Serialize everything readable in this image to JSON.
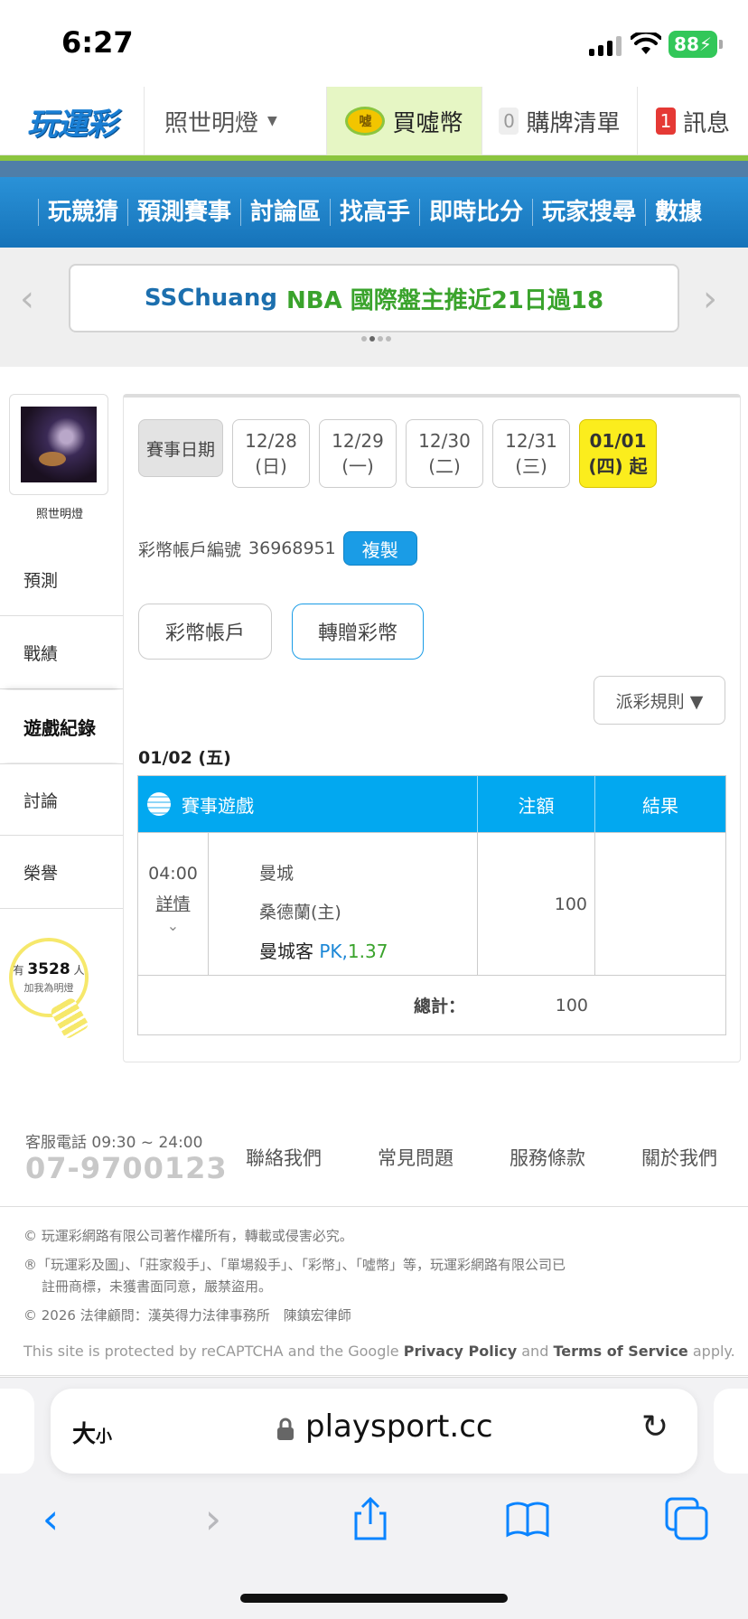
{
  "status_bar": {
    "time": "6:27",
    "battery": "88"
  },
  "topnav": {
    "logo": "玩運彩",
    "user": "照世明燈",
    "buy_coin": "買噓幣",
    "coin_icon_text": "噓",
    "cart_count": "0",
    "cart_label": "購牌清單",
    "msg_count": "1",
    "msg_label": "訊息"
  },
  "mainnav": [
    "玩競猜",
    "預測賽事",
    "討論區",
    "找高手",
    "即時比分",
    "玩家搜尋",
    "數據"
  ],
  "banner": {
    "part1": "SSChuang",
    "part2": "NBA 國際盤主推近21日過18"
  },
  "sidebar": {
    "name": "照世明燈",
    "items": [
      "預測",
      "戰績",
      "遊戲紀錄",
      "討論",
      "榮譽"
    ],
    "active": "遊戲紀錄",
    "fans_prefix": "有",
    "fans_count": "3528",
    "fans_suffix": "人",
    "fans_note": "加我為明燈"
  },
  "content": {
    "date_label": "賽事日期",
    "dates": [
      {
        "date": "12/28",
        "day": "(日)"
      },
      {
        "date": "12/29",
        "day": "(一)"
      },
      {
        "date": "12/30",
        "day": "(二)"
      },
      {
        "date": "12/31",
        "day": "(三)"
      },
      {
        "date": "01/01",
        "day": "(四) 起"
      }
    ],
    "selected_date": "01/01",
    "account_label": "彩幣帳戶編號",
    "account_number": "36968951",
    "copy_label": "複製",
    "tab_account": "彩幣帳戶",
    "tab_transfer": "轉贈彩幣",
    "rules_label": "派彩規則 ▼",
    "section_date": "01/02 (五)",
    "table": {
      "headers": [
        "賽事遊戲",
        "注額",
        "結果"
      ],
      "rows": [
        {
          "time": "04:00",
          "detail_label": "詳情",
          "away": "曼城",
          "home": "桑德蘭(主)",
          "pick": "曼城客",
          "pick_type": "PK,",
          "odds": "1.37",
          "amount": "100",
          "result": ""
        }
      ],
      "total_label": "總計：",
      "total_value": "100"
    }
  },
  "footer": {
    "cs_label": "客服電話 09:30 ~ 24:00",
    "cs_phone": "07-9700123",
    "links": [
      "聯絡我們",
      "常見問題",
      "服務條款",
      "關於我們"
    ],
    "copyright": "© 玩運彩網路有限公司著作權所有，轉載或侵害必究。",
    "trademark": "®「玩運彩及圖」、「莊家殺手」、「單場殺手」、「彩幣」、「噓幣」等，玩運彩網路有限公司已",
    "trademark2": "註冊商標，未獲書面同意，嚴禁盜用。",
    "legal": "© 2026 法律顧問：漢英得力法律事務所　陳鎮宏律師",
    "recaptcha_pre": "This site is protected by reCAPTCHA and the Google ",
    "privacy": "Privacy Policy",
    "recaptcha_and": " and ",
    "terms": "Terms of Service",
    "recaptcha_post": " apply."
  },
  "browser": {
    "text_size_big": "大",
    "text_size_small": "小",
    "url": "playsport.cc"
  },
  "colors": {
    "brand_blue": "#1673b9",
    "accent_green": "#8bc53f",
    "table_header": "#02a8f0",
    "selected_date": "#fbed1d",
    "copy_button": "#1a9ce6"
  }
}
